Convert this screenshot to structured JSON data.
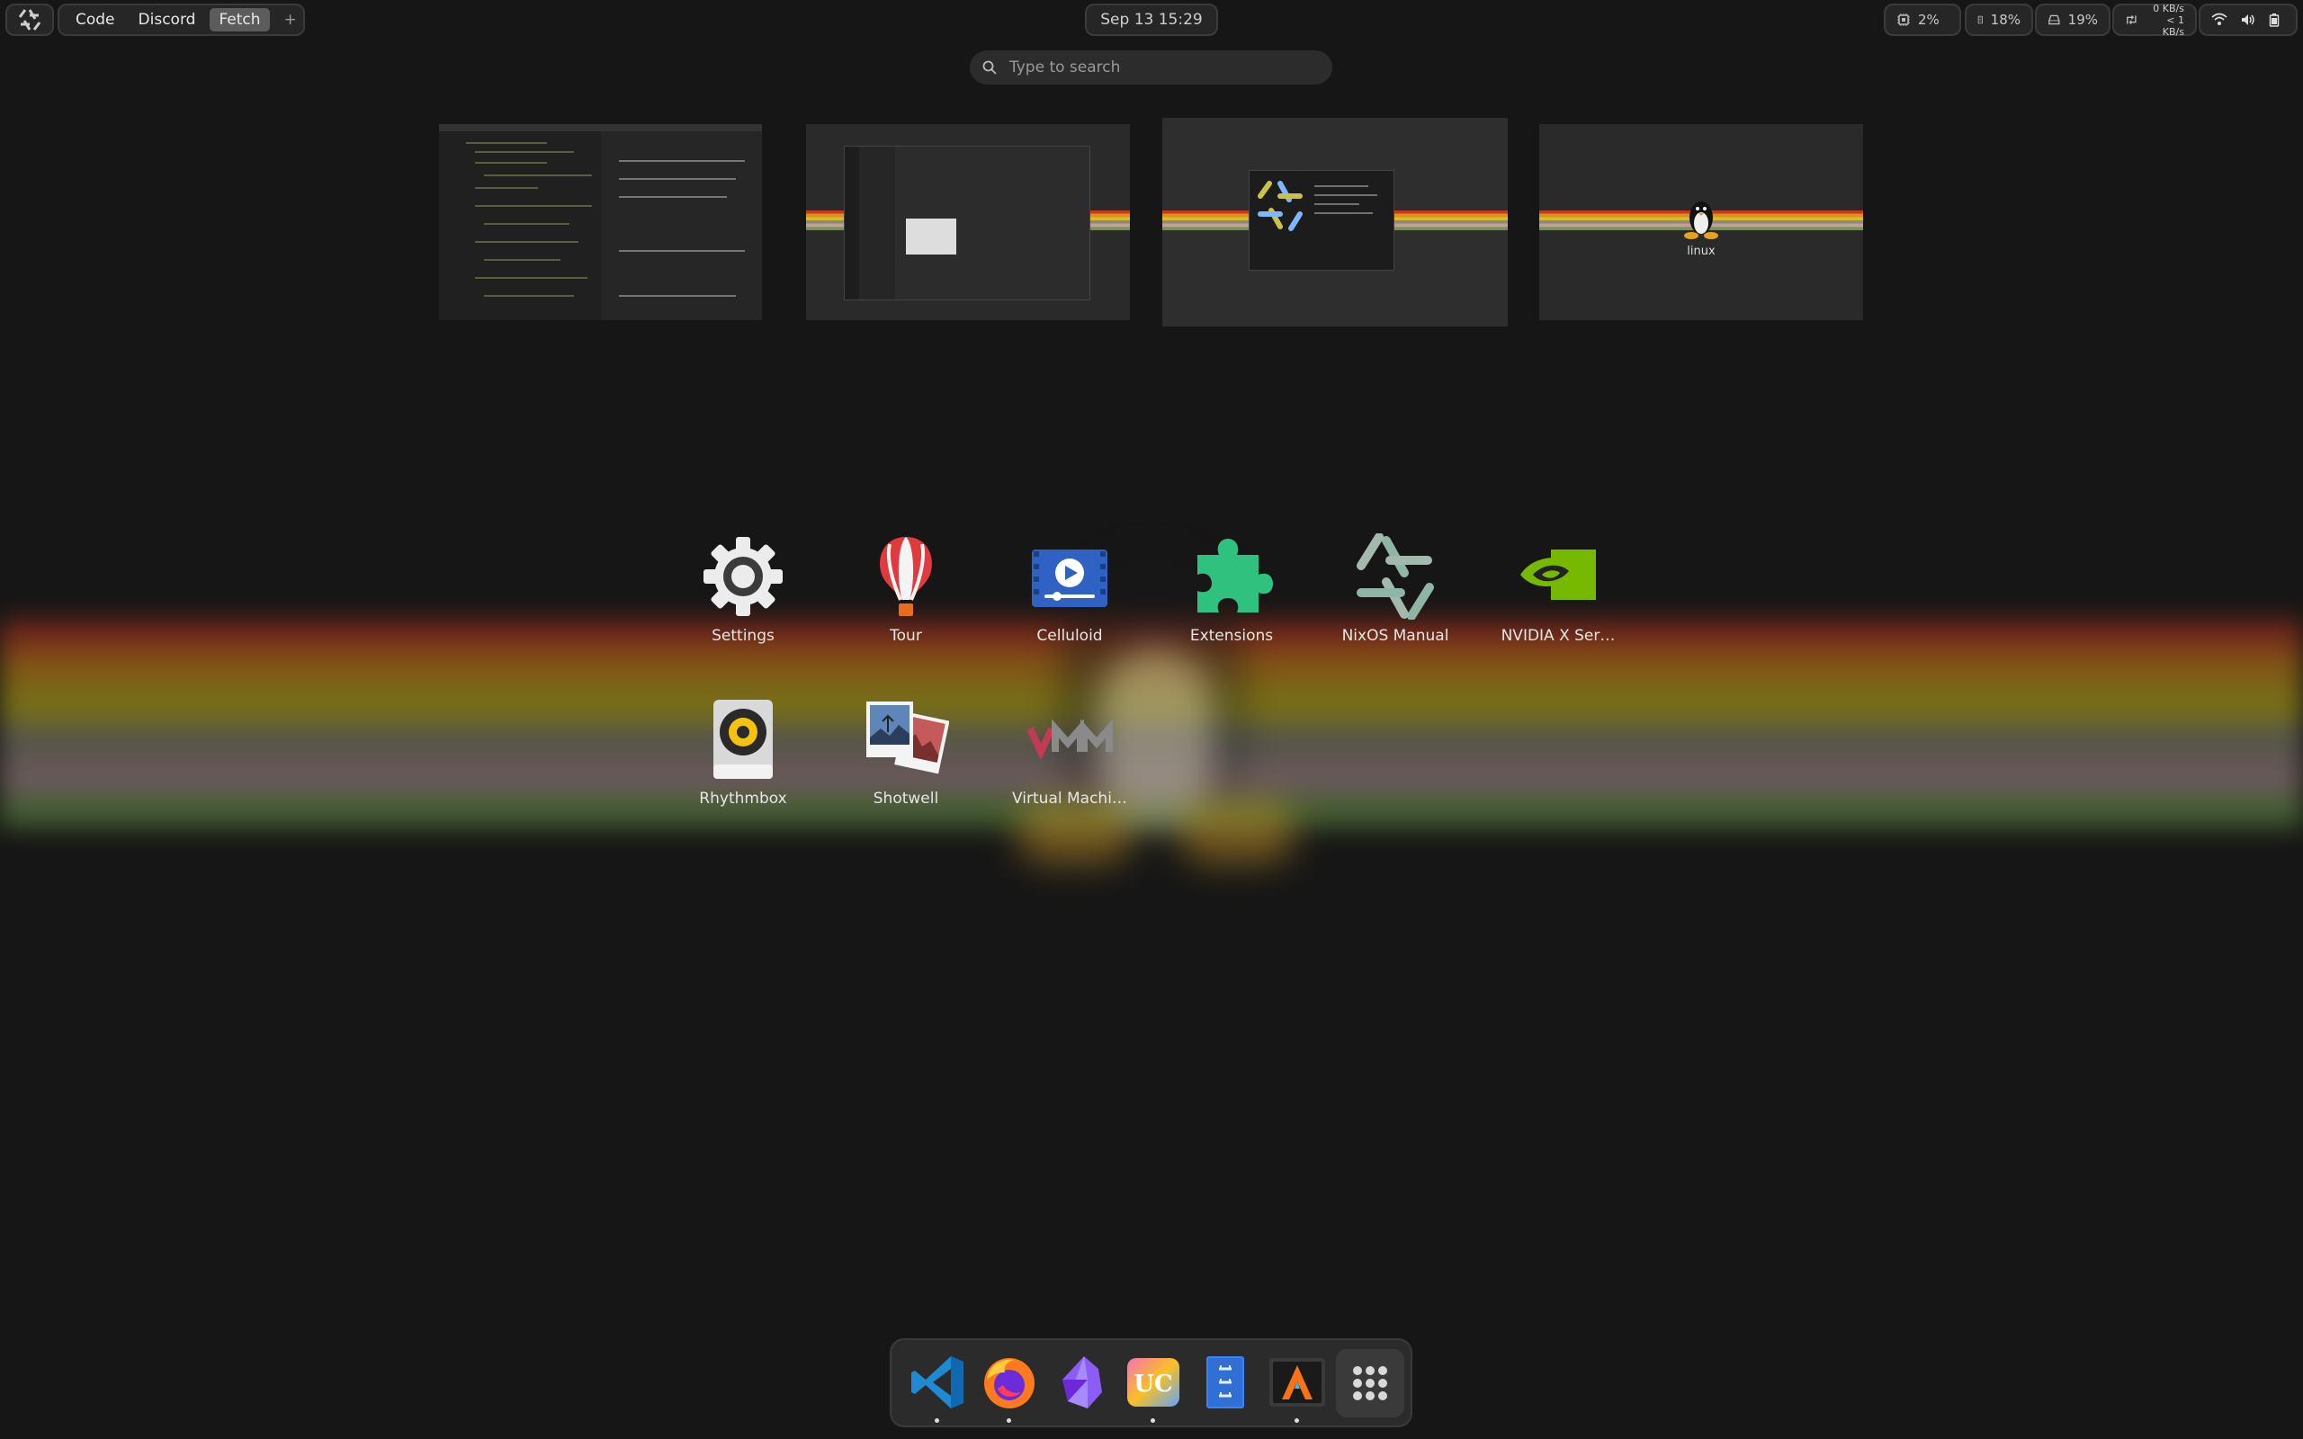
{
  "topbar": {
    "workspaces": [
      "Code",
      "Discord",
      "Fetch"
    ],
    "active_workspace": "Fetch",
    "add_label": "+",
    "clock": "Sep 13  15:29",
    "cpu": "2%",
    "memory": "18%",
    "disk": "19%",
    "net_down": "0 KB/s",
    "net_up": "< 1 KB/s"
  },
  "search": {
    "placeholder": "Type to search"
  },
  "workspace_previews": [
    {
      "name": "Code"
    },
    {
      "name": "Discord"
    },
    {
      "name": "Fetch"
    },
    {
      "name": "linux",
      "label": "linux"
    }
  ],
  "apps": [
    {
      "label": "Settings",
      "icon": "settings-gear-icon"
    },
    {
      "label": "Tour",
      "icon": "hot-air-balloon-icon"
    },
    {
      "label": "Celluloid",
      "icon": "video-player-icon"
    },
    {
      "label": "Extensions",
      "icon": "puzzle-piece-icon"
    },
    {
      "label": "NixOS Manual",
      "icon": "nixos-snowflake-icon"
    },
    {
      "label": "NVIDIA X Ser…",
      "icon": "nvidia-eye-icon"
    },
    {
      "label": "Rhythmbox",
      "icon": "speaker-icon"
    },
    {
      "label": "Shotwell",
      "icon": "photos-icon"
    },
    {
      "label": "Virtual Machi…",
      "icon": "vmm-icon"
    }
  ],
  "dock": [
    {
      "icon": "vscode-icon",
      "running": true
    },
    {
      "icon": "firefox-icon",
      "running": true
    },
    {
      "icon": "obsidian-icon",
      "running": false
    },
    {
      "icon": "unciv-icon",
      "running": true
    },
    {
      "icon": "file-manager-icon",
      "running": false
    },
    {
      "icon": "alacritty-terminal-icon",
      "running": true
    },
    {
      "icon": "app-grid-icon",
      "running": false
    }
  ],
  "colors": {
    "background": "#161616",
    "nvidia_green": "#76b900",
    "extensions_green": "#26a269"
  }
}
